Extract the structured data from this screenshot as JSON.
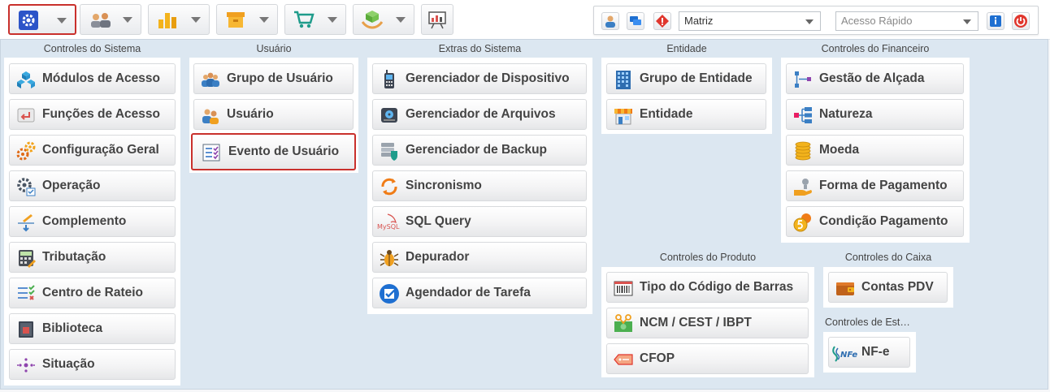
{
  "right_panel": {
    "entity_value": "Matriz",
    "quick_access_placeholder": "Acesso Rápido"
  },
  "groups": {
    "sistema": {
      "title": "Controles do Sistema",
      "items": [
        "Módulos de Acesso",
        "Funções de Acesso",
        "Configuração Geral",
        "Operação",
        "Complemento",
        "Tributação",
        "Centro de Rateio",
        "Biblioteca",
        "Situação"
      ]
    },
    "usuario": {
      "title": "Usuário",
      "items": [
        "Grupo de Usuário",
        "Usuário",
        "Evento de Usuário"
      ]
    },
    "extras": {
      "title": "Extras do Sistema",
      "items": [
        "Gerenciador de Dispositivo",
        "Gerenciador de Arquivos",
        "Gerenciador de Backup",
        "Sincronismo",
        "SQL Query",
        "Depurador",
        "Agendador de Tarefa"
      ]
    },
    "entidade": {
      "title": "Entidade",
      "items": [
        "Grupo de Entidade",
        "Entidade"
      ]
    },
    "financeiro": {
      "title": "Controles do Financeiro",
      "items": [
        "Gestão de Alçada",
        "Natureza",
        "Moeda",
        "Forma de Pagamento",
        "Condição Pagamento"
      ]
    },
    "produto": {
      "title": "Controles do Produto",
      "items": [
        "Tipo do Código de Barras",
        "NCM / CEST / IBPT",
        "CFOP"
      ]
    },
    "caixa": {
      "title": "Controles do Caixa",
      "items": [
        "Contas PDV"
      ]
    },
    "estoque": {
      "title": "Controles de Est…",
      "items": [
        "NF-e"
      ]
    }
  },
  "colors": {
    "accent_selected": "#c9302c",
    "menu_bg": "#dce7f1",
    "gear_blue": "#2c54c8"
  }
}
